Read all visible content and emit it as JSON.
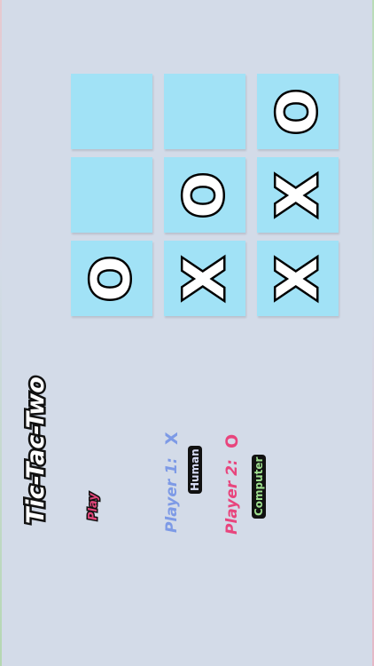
{
  "app": {
    "title": "Tic-Tac-Two",
    "play_label": "Play"
  },
  "players": [
    {
      "label": "Player 1:",
      "symbol": "X",
      "type": "Human",
      "color": "#7d9ae6",
      "type_color": "#d7dcf4"
    },
    {
      "label": "Player 2:",
      "symbol": "O",
      "type": "Computer",
      "color": "#e8457d",
      "type_color": "#9fe08f"
    }
  ],
  "board": {
    "rows": [
      [
        "",
        "",
        "O"
      ],
      [
        "",
        "O",
        "X"
      ],
      [
        "O",
        "X",
        "X"
      ]
    ]
  },
  "colors": {
    "background": "#d3dbe8",
    "cell": "#a1e2f6",
    "mark_fill": "#ffffff",
    "mark_outline": "#000000"
  }
}
